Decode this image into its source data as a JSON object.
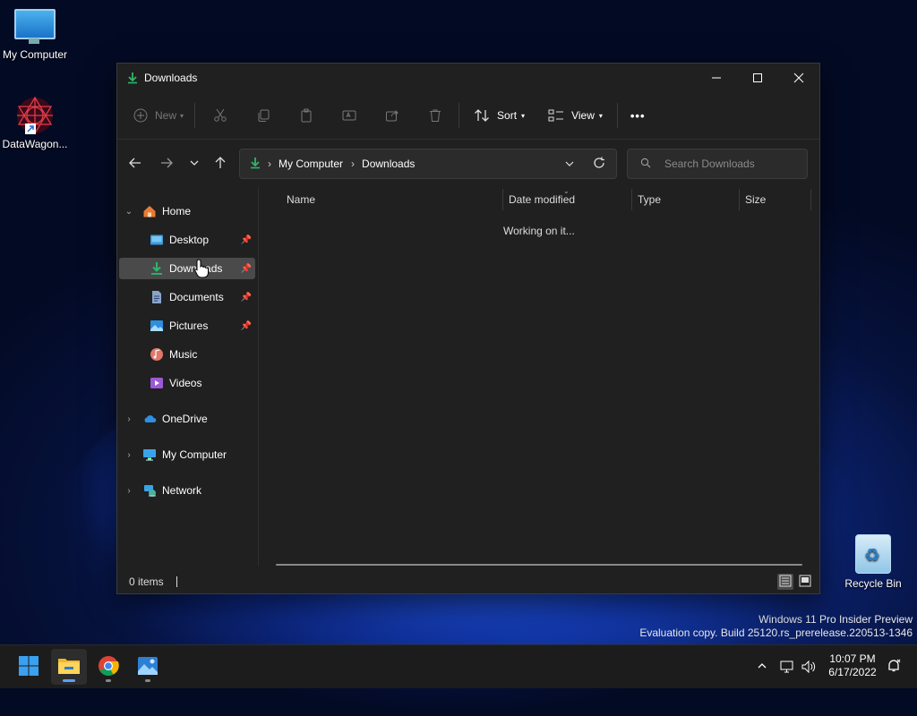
{
  "desktop": {
    "icons": [
      {
        "label": "My Computer"
      },
      {
        "label": "DataWagon..."
      },
      {
        "label": "Recycle Bin"
      }
    ],
    "watermark": {
      "line1": "Windows 11 Pro Insider Preview",
      "line2": "Evaluation copy. Build 25120.rs_prerelease.220513-1346"
    }
  },
  "window": {
    "title": "Downloads",
    "controls": {
      "minimize": "—",
      "maximize": "☐",
      "close": "✕"
    },
    "toolbar": {
      "new_label": "New",
      "sort_label": "Sort",
      "view_label": "View",
      "more_label": "•••"
    },
    "address": {
      "segments": [
        "My Computer",
        "Downloads"
      ]
    },
    "search": {
      "placeholder": "Search Downloads"
    },
    "sidebar": {
      "home": "Home",
      "quick": [
        {
          "label": "Desktop",
          "pinned": true
        },
        {
          "label": "Downloads",
          "pinned": true,
          "selected": true
        },
        {
          "label": "Documents",
          "pinned": true
        },
        {
          "label": "Pictures",
          "pinned": true
        },
        {
          "label": "Music",
          "pinned": false
        },
        {
          "label": "Videos",
          "pinned": false
        }
      ],
      "groups": [
        "OneDrive",
        "My Computer",
        "Network"
      ]
    },
    "columns": [
      "Name",
      "Date modified",
      "Type",
      "Size"
    ],
    "status_message": "Working on it...",
    "statusbar": {
      "items": "0 items"
    }
  },
  "taskbar": {
    "clock": {
      "time": "10:07 PM",
      "date": "6/17/2022"
    }
  },
  "colors": {
    "accent": "#5aa0ff",
    "download_green": "#2fb66b",
    "window_bg": "#202020"
  }
}
